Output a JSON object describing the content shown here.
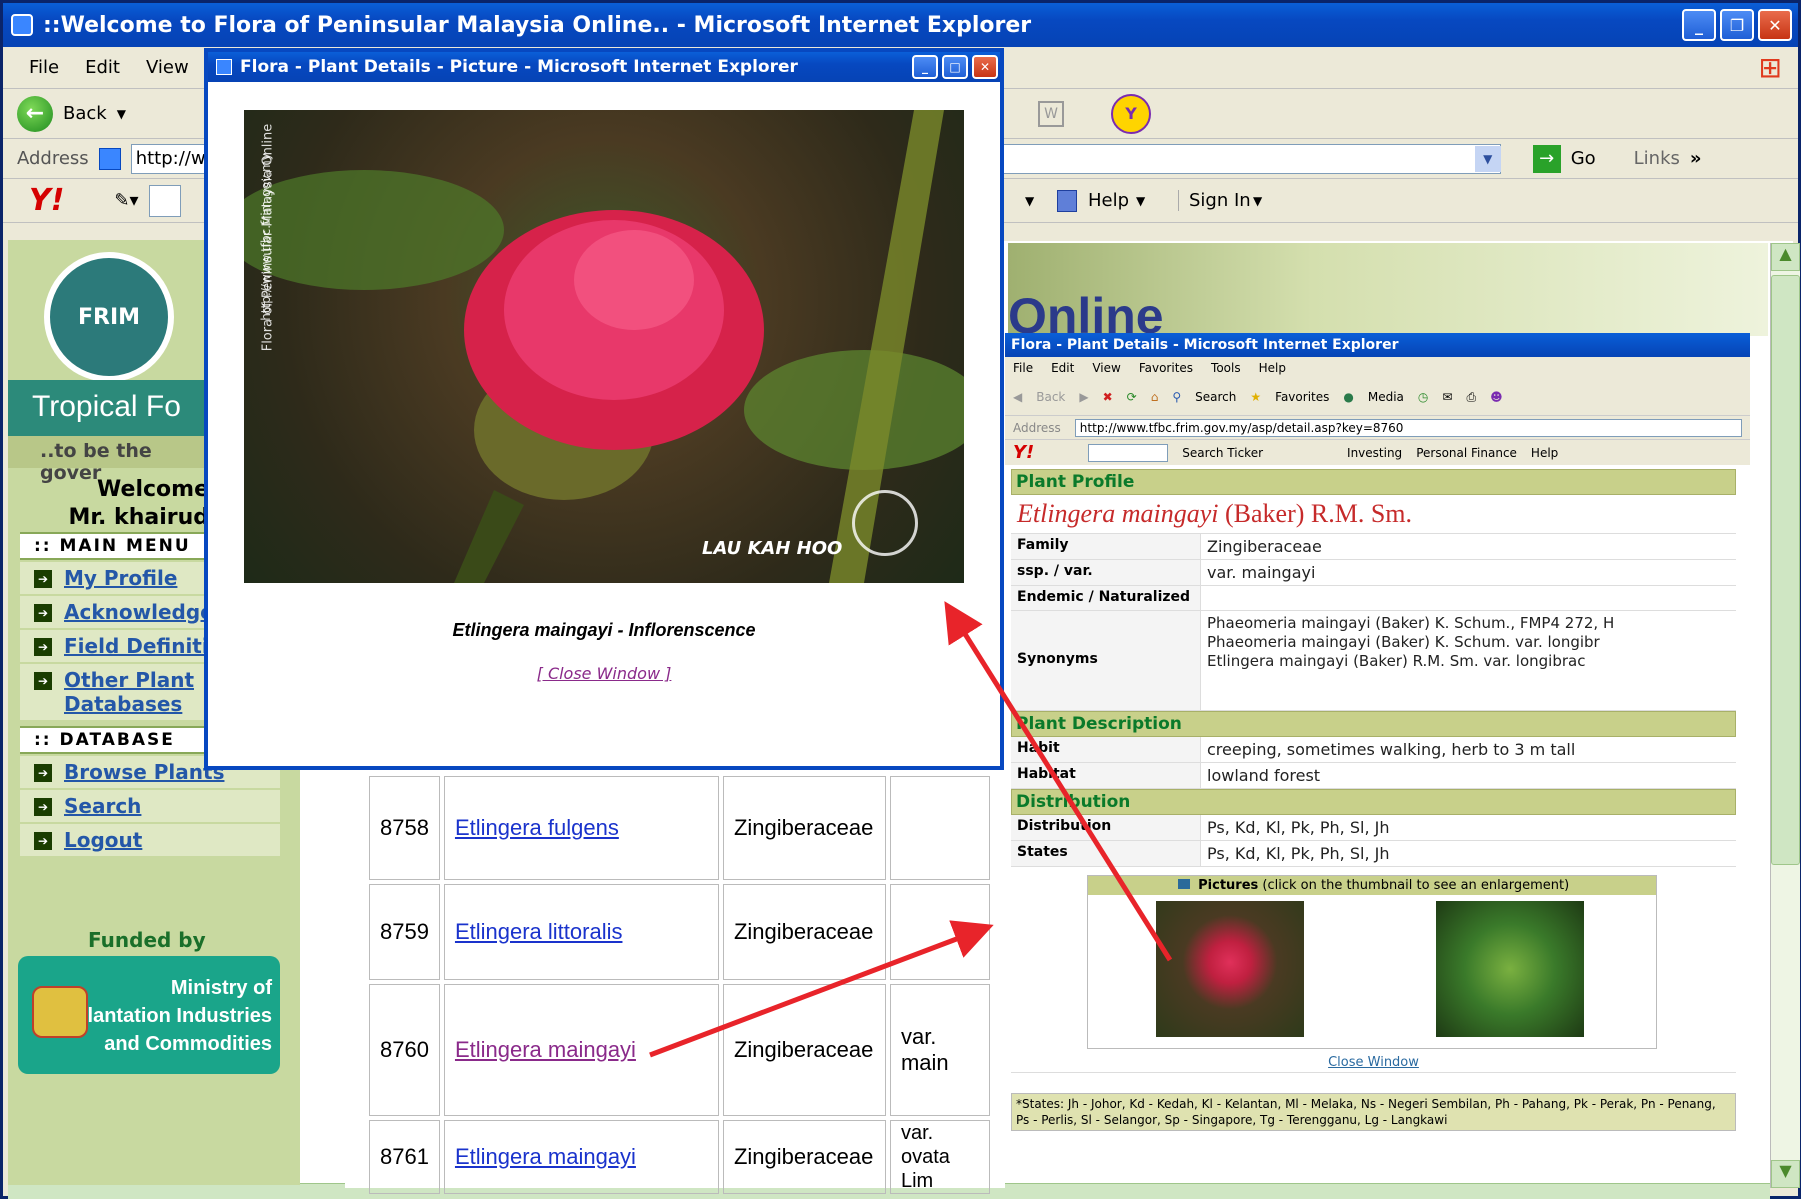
{
  "main_window": {
    "title": "::Welcome to Flora of Peninsular Malaysia Online.. - Microsoft Internet Explorer",
    "menu": [
      "File",
      "Edit",
      "View"
    ],
    "toolbar": {
      "back_label": "Back"
    },
    "address": {
      "label": "Address",
      "value": "http://w",
      "go_label": "Go",
      "links_label": "Links"
    },
    "help_label": "Help",
    "signin_label": "Sign In"
  },
  "sidebar": {
    "logo_text": "FRIM",
    "site_title": "Tropical Fo",
    "tagline": "..to be the gover",
    "welcome_line1": "Welcome",
    "welcome_line2": "Mr. khairud",
    "main_menu_head": ":: MAIN MENU",
    "main_menu": [
      "My Profile",
      "Acknowledgen",
      "Field Definition",
      "Other Plant Databases"
    ],
    "database_head": ":: DATABASE",
    "database_menu": [
      "Browse Plants",
      "Search",
      "Logout"
    ],
    "funded_by": "Funded by",
    "ministry": [
      "Ministry of",
      "Plantation Industries",
      "and Commodities"
    ]
  },
  "plants_table": [
    {
      "id": "8758",
      "name": "Etlingera fulgens",
      "family": "Zingiberaceae",
      "var": ""
    },
    {
      "id": "8759",
      "name": "Etlingera littoralis",
      "family": "Zingiberaceae",
      "var": ""
    },
    {
      "id": "8760",
      "name": "Etlingera maingayi",
      "family": "Zingiberaceae",
      "var": "var. main"
    },
    {
      "id": "8761",
      "name": "Etlingera maingayi",
      "family": "Zingiberaceae",
      "var": "var. ovata Lim"
    }
  ],
  "picture_popup": {
    "title": "Flora - Plant Details - Picture - Microsoft Internet Explorer",
    "watermark_vertical": "Flora of Peninsular Malaysia Online",
    "watermark_url": "http://www.tfbc.frim.gov.my",
    "photographer": "LAU KAH HOO",
    "caption": "Etlingera maingayi - Inflorenscence",
    "close_label": "[ Close Window ]"
  },
  "details_popup": {
    "title": "Flora - Plant Details - Microsoft Internet Explorer",
    "menu": [
      "File",
      "Edit",
      "View",
      "Favorites",
      "Tools",
      "Help"
    ],
    "toolbar": [
      "Back",
      "Search",
      "Favorites",
      "Media"
    ],
    "address_label": "Address",
    "address_value": "http://www.tfbc.frim.gov.my/asp/detail.asp?key=8760",
    "yahoo_bar": [
      "Search Ticker",
      "Investing",
      "Personal Finance",
      "Help"
    ],
    "plant_profile_head": "Plant Profile",
    "species": "Etlingera maingayi",
    "authority": "(Baker) R.M. Sm.",
    "profile": [
      {
        "k": "Family",
        "v": "Zingiberaceae"
      },
      {
        "k": "ssp. / var.",
        "v": "var. maingayi"
      },
      {
        "k": "Endemic / Naturalized",
        "v": ""
      }
    ],
    "synonyms_label": "Synonyms",
    "synonyms": [
      "Phaeomeria maingayi (Baker) K. Schum., FMP4 272, H",
      "Phaeomeria maingayi (Baker) K. Schum. var. longibr",
      "Etlingera maingayi (Baker) R.M. Sm. var. longibrac"
    ],
    "plant_desc_head": "Plant Description",
    "description": [
      {
        "k": "Habit",
        "v": "creeping, sometimes walking, herb to 3 m tall"
      },
      {
        "k": "Habitat",
        "v": "lowland forest"
      }
    ],
    "distribution_head": "Distribution",
    "distribution": [
      {
        "k": "Distribution",
        "v": "Ps, Kd, Kl, Pk, Ph, Sl, Jh"
      },
      {
        "k": "States",
        "v": "Ps, Kd, Kl, Pk, Ph, Sl, Jh"
      }
    ],
    "pictures_label": "Pictures",
    "pictures_note": "(click on the thumbnail to see an enlargement)",
    "close_label": "Close Window",
    "states_footnote": "*States: Jh - Johor, Kd - Kedah, Kl - Kelantan, Ml - Melaka, Ns - Negeri Sembilan, Ph - Pahang, Pk - Perak, Pn - Penang, Ps - Perlis, Sl - Selangor, Sp - Singapore, Tg - Terengganu, Lg - Langkawi"
  },
  "colors": {
    "xp_blue": "#0748c0",
    "arrow": "#e8242a",
    "section": "#c8d08a",
    "section_text": "#0a7a2a"
  }
}
